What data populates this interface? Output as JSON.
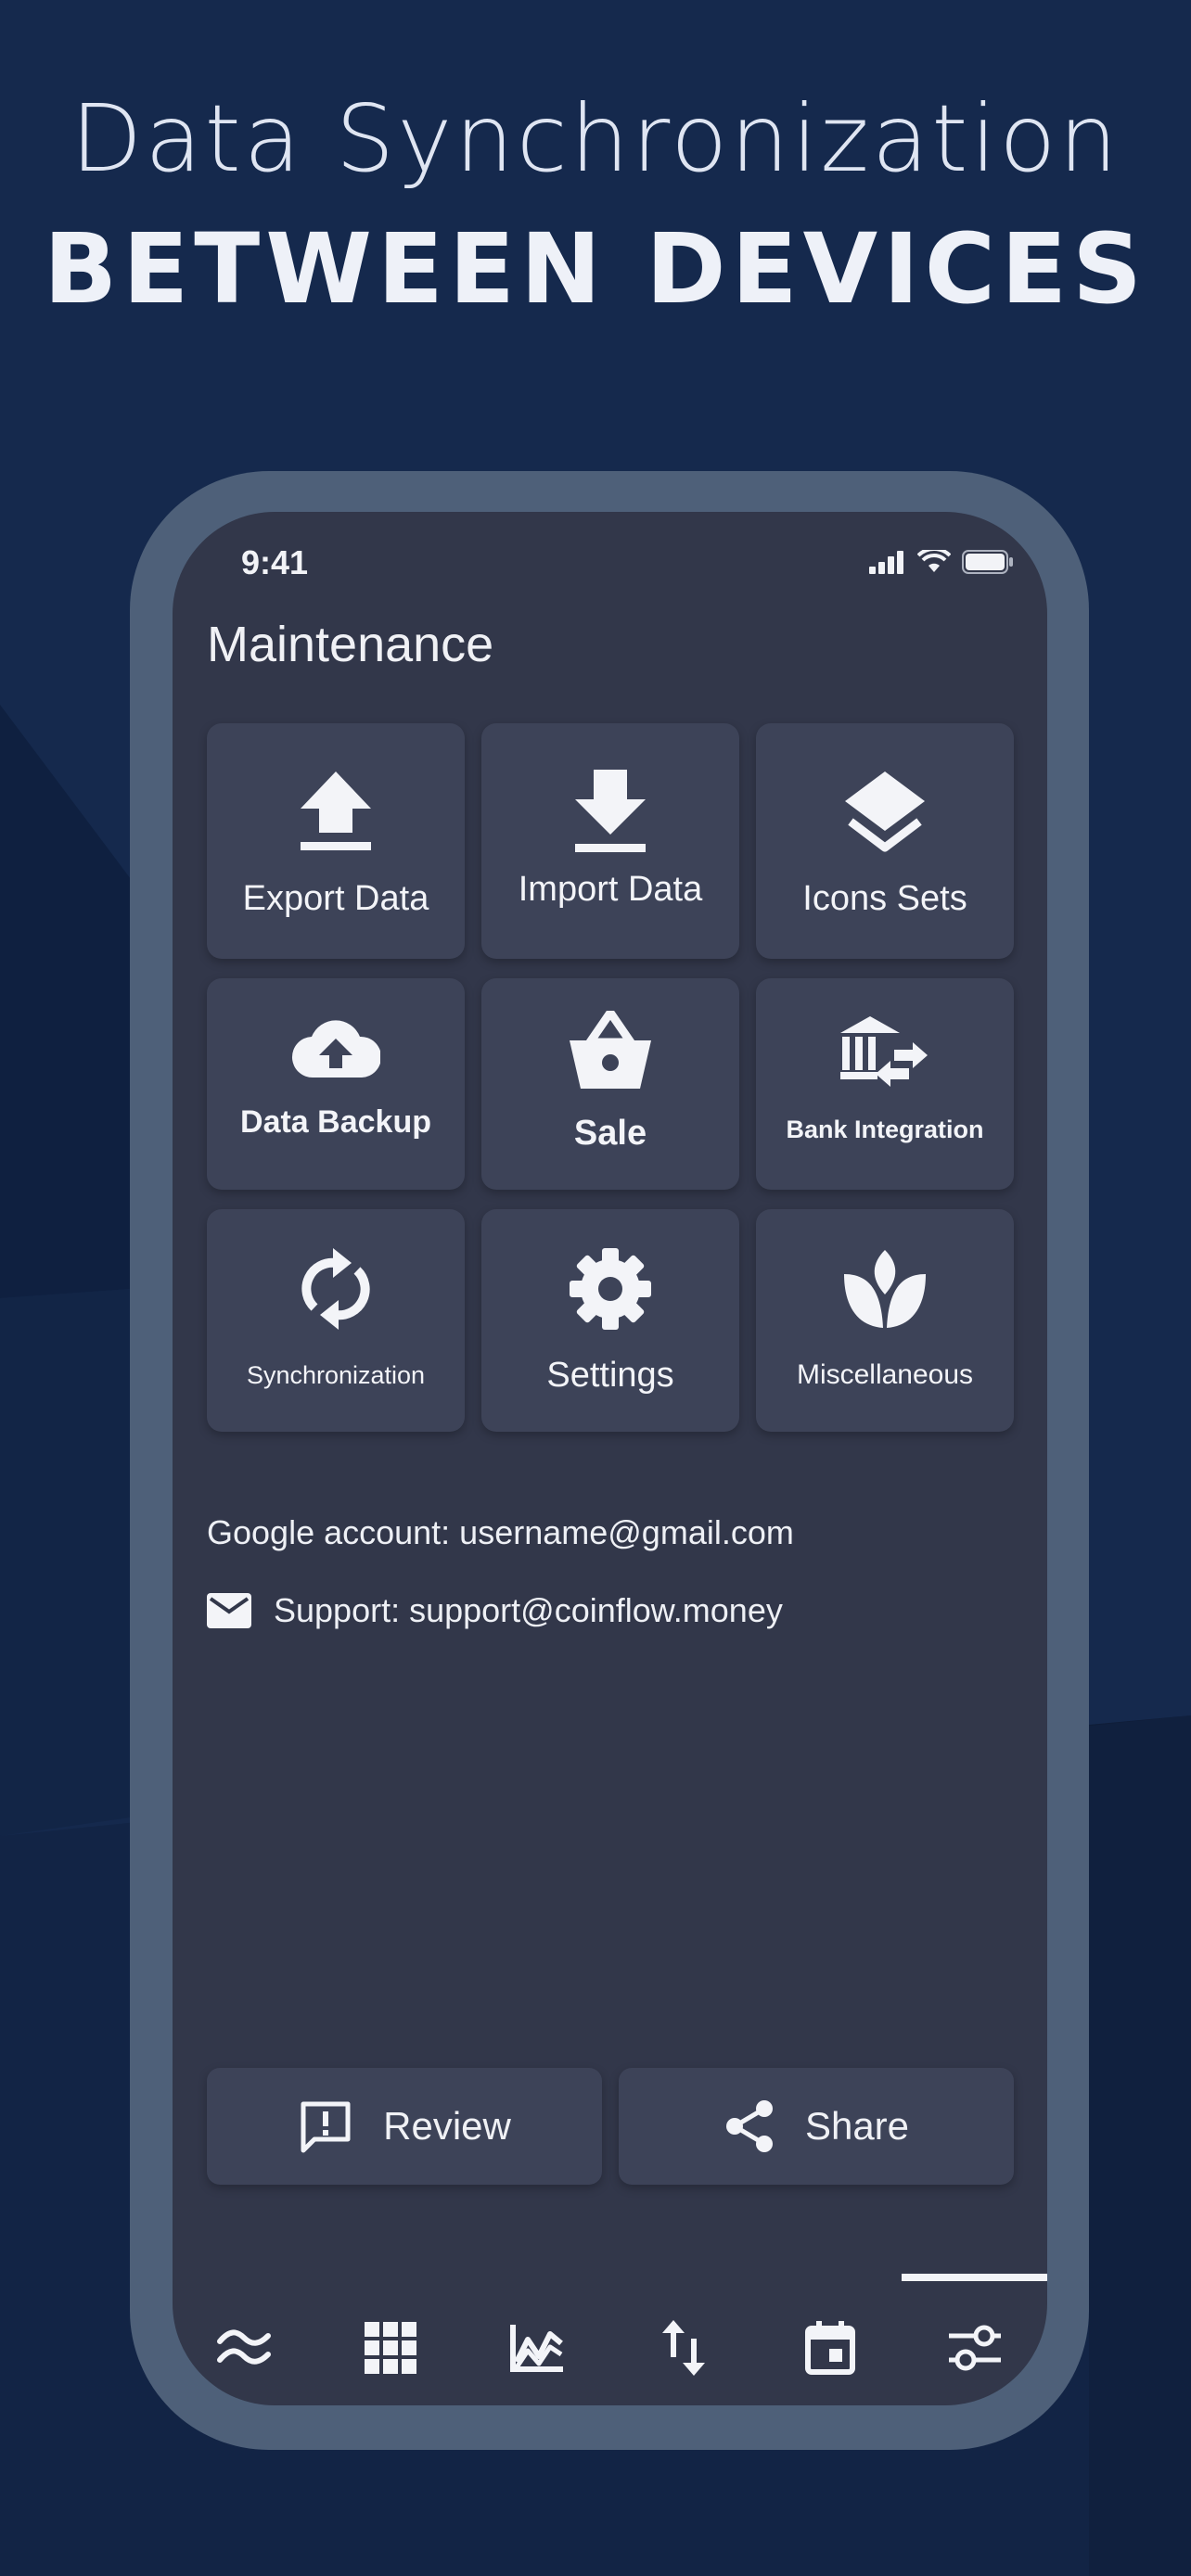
{
  "headline": {
    "line1": "Data Synchronization",
    "line2": "BETWEEN DEVICES"
  },
  "status": {
    "time": "9:41"
  },
  "screen_title": "Maintenance",
  "tiles": [
    {
      "label": "Export Data",
      "icon": "upload-icon"
    },
    {
      "label": "Import Data",
      "icon": "download-icon"
    },
    {
      "label": "Icons Sets",
      "icon": "layers-icon"
    },
    {
      "label": "Data Backup",
      "icon": "cloud-upload-icon"
    },
    {
      "label": "Sale",
      "icon": "basket-icon"
    },
    {
      "label": "Bank Integration",
      "icon": "bank-transfer-icon"
    },
    {
      "label": "Synchronization",
      "icon": "sync-icon"
    },
    {
      "label": "Settings",
      "icon": "gear-icon"
    },
    {
      "label": "Miscellaneous",
      "icon": "leaf-icon"
    }
  ],
  "google_account": "Google account: username@gmail.com",
  "support": "Support: support@coinflow.money",
  "buttons": {
    "review": "Review",
    "share": "Share"
  },
  "tabs": [
    {
      "icon": "waves-icon"
    },
    {
      "icon": "grid-icon"
    },
    {
      "icon": "chart-icon"
    },
    {
      "icon": "transfer-arrows-icon"
    },
    {
      "icon": "calendar-icon"
    },
    {
      "icon": "sliders-icon",
      "active": true
    }
  ],
  "colors": {
    "background": "#14284c",
    "frame": "#4e6079",
    "screen": "#32374a",
    "tile": "#3d4358",
    "text": "#f0f1f5"
  }
}
